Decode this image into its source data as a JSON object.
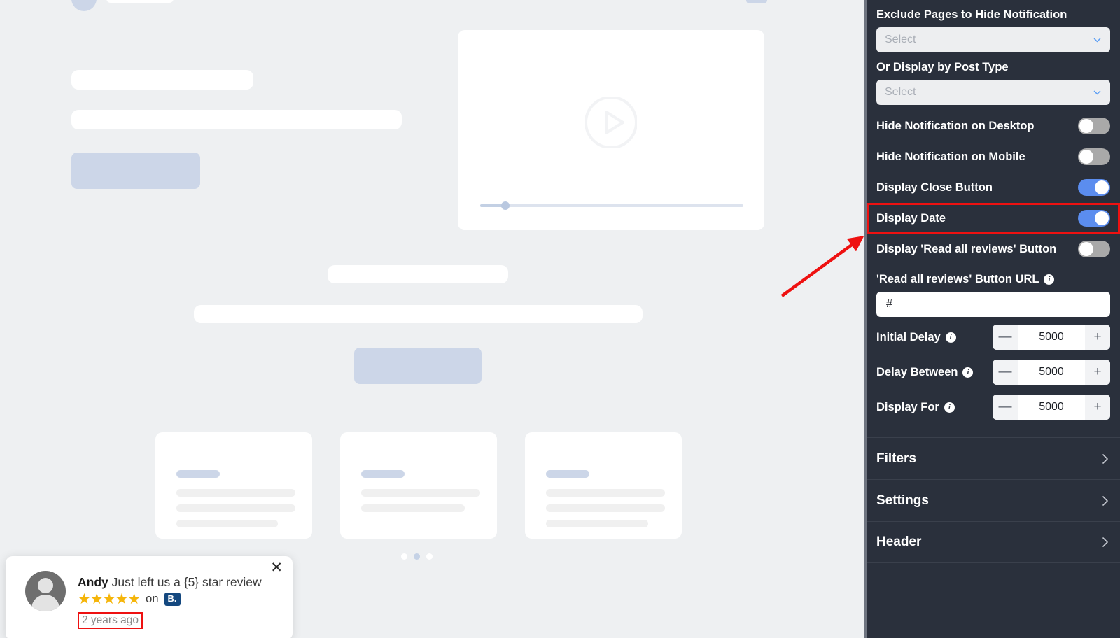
{
  "panel": {
    "exclude_pages": {
      "label": "Exclude Pages to Hide Notification",
      "placeholder": "Select",
      "value": ""
    },
    "post_type": {
      "label": "Or Display by Post Type",
      "placeholder": "Select",
      "value": ""
    },
    "toggles": [
      {
        "label": "Hide Notification on Desktop",
        "state": "off",
        "highlighted": false
      },
      {
        "label": "Hide Notification on Mobile",
        "state": "off",
        "highlighted": false
      },
      {
        "label": "Display Close Button",
        "state": "on",
        "highlighted": false
      },
      {
        "label": "Display Date",
        "state": "on",
        "highlighted": true
      },
      {
        "label": "Display 'Read all reviews' Button",
        "state": "off",
        "highlighted": false
      }
    ],
    "button_url": {
      "label": "'Read all reviews' Button URL",
      "info": "i",
      "value": "#"
    },
    "steppers": [
      {
        "label": "Initial Delay",
        "info": "i",
        "value": "5000",
        "minus": "—",
        "plus": "+"
      },
      {
        "label": "Delay Between",
        "info": "i",
        "value": "5000",
        "minus": "—",
        "plus": "+"
      },
      {
        "label": "Display For",
        "info": "i",
        "value": "5000",
        "minus": "—",
        "plus": "+"
      }
    ],
    "accordion": [
      {
        "label": "Filters"
      },
      {
        "label": "Settings"
      },
      {
        "label": "Header"
      }
    ]
  },
  "notification": {
    "name": "Andy",
    "message": "Just left us a {5} star review",
    "stars": "★★★★★",
    "on_word": "on",
    "platform_badge": "B.",
    "date": "2 years ago",
    "close": "✕"
  },
  "preview": {
    "pagination_dots": 3,
    "active_dot_index": 1
  },
  "colors": {
    "panel_bg": "#2a303c",
    "accent_blue": "#5b8def",
    "toggle_off": "#a9a9a9",
    "annotation_red": "#ee1111",
    "star_gold": "#f5b50a",
    "badge_blue": "#14487f",
    "preview_bg": "#eef0f2",
    "skeleton_blue": "#ccd6e8"
  }
}
